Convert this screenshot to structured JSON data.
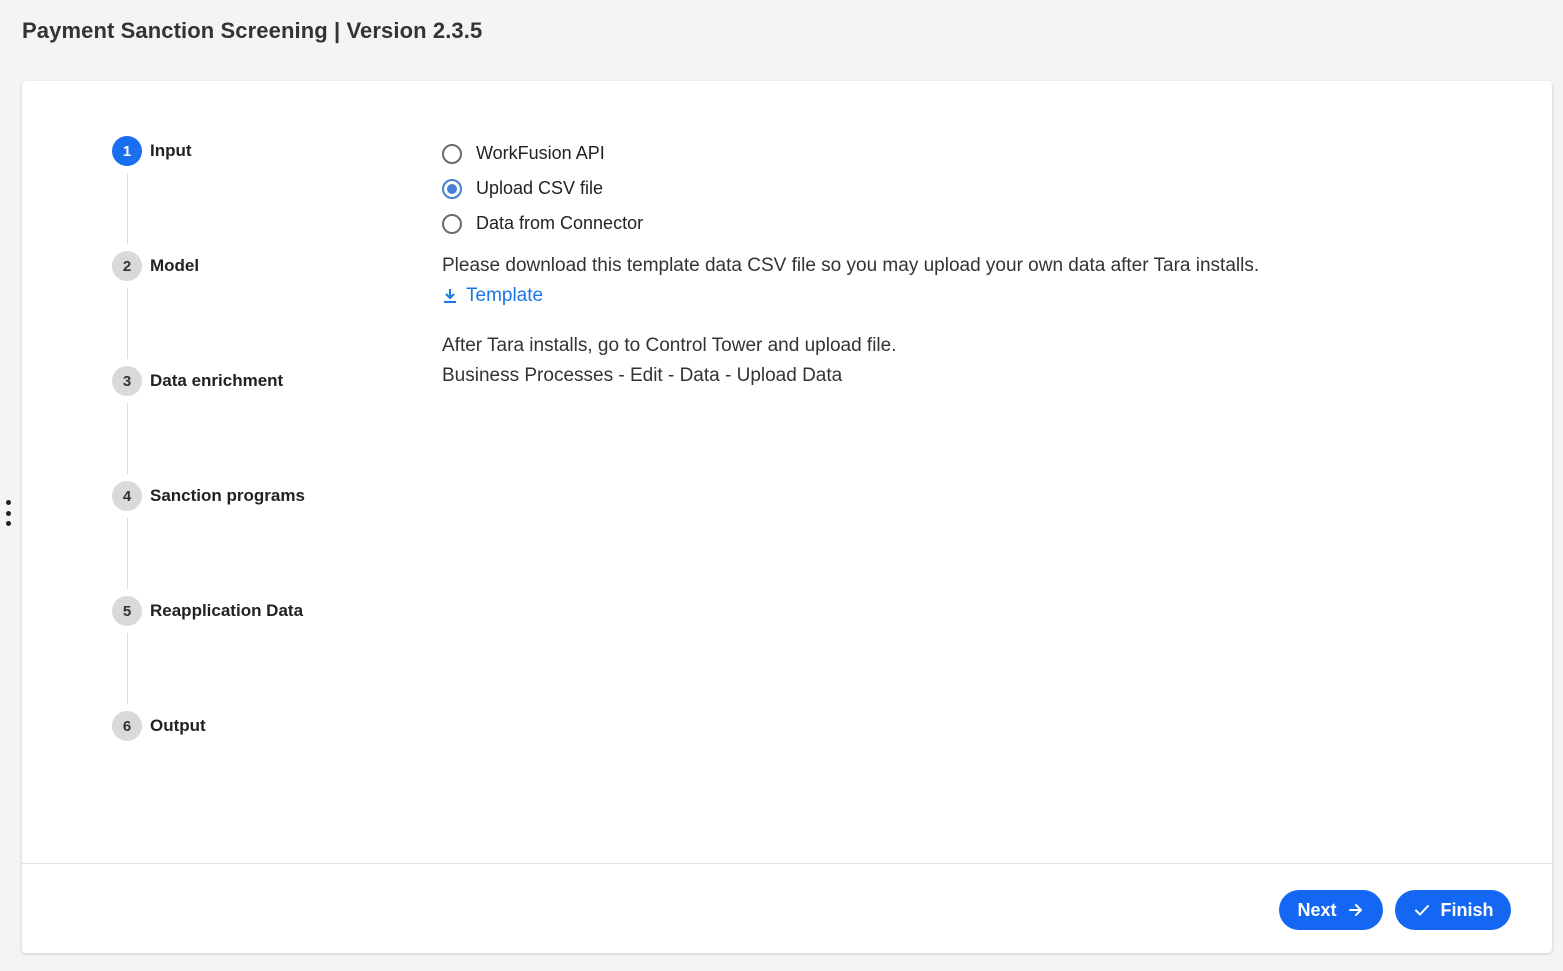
{
  "header": {
    "title": "Payment Sanction Screening | Version 2.3.5"
  },
  "sidebar_toggle": {
    "icon": "more-vertical-icon"
  },
  "steps": [
    {
      "number": "1",
      "label": "Input",
      "active": true
    },
    {
      "number": "2",
      "label": "Model",
      "active": false
    },
    {
      "number": "3",
      "label": "Data enrichment",
      "active": false
    },
    {
      "number": "4",
      "label": "Sanction programs",
      "active": false
    },
    {
      "number": "5",
      "label": "Reapplication Data",
      "active": false
    },
    {
      "number": "6",
      "label": "Output",
      "active": false
    }
  ],
  "input_options": [
    {
      "label": "WorkFusion API",
      "checked": false
    },
    {
      "label": "Upload CSV file",
      "checked": true
    },
    {
      "label": "Data from Connector",
      "checked": false
    }
  ],
  "instructions": {
    "download_text": "Please download this template data CSV file so you may upload your own data after Tara installs.",
    "template_link": "Template",
    "after_line1": "After Tara installs, go to Control Tower and upload file.",
    "after_line2": "Business Processes - Edit - Data - Upload Data"
  },
  "footer": {
    "next_label": "Next",
    "finish_label": "Finish"
  },
  "colors": {
    "accent": "#1367f2",
    "link": "#1a78e6",
    "radio_checked": "#4a7fd6",
    "step_inactive": "#d9d9d9"
  }
}
